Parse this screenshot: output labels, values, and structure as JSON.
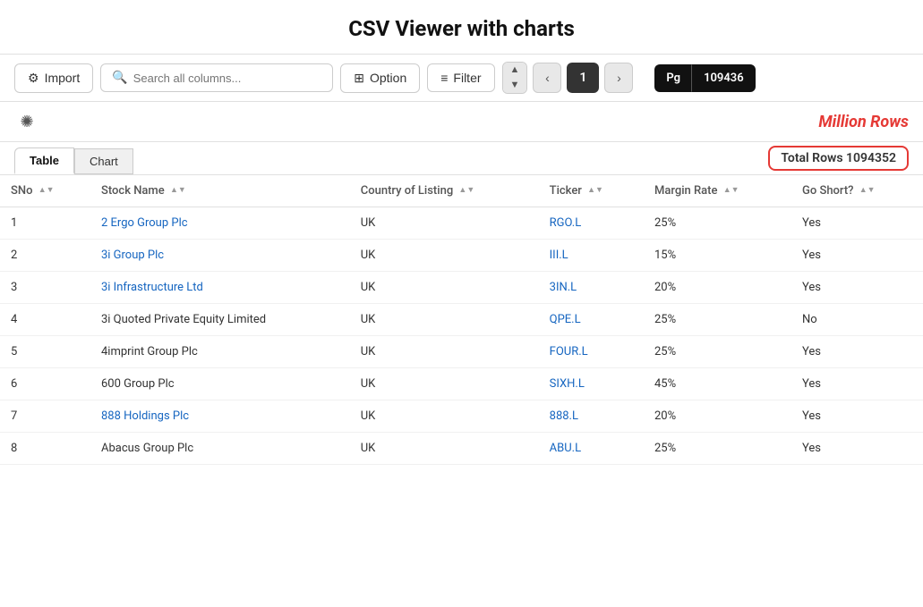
{
  "page": {
    "title": "CSV Viewer with charts"
  },
  "toolbar": {
    "import_label": "Import",
    "search_placeholder": "Search all columns...",
    "option_label": "Option",
    "filter_label": "Filter",
    "page_current": "1",
    "page_total": "109436",
    "pg_label": "Pg"
  },
  "million_rows": {
    "label": "Million Rows"
  },
  "tabs": [
    {
      "id": "table",
      "label": "Table",
      "active": true
    },
    {
      "id": "chart",
      "label": "Chart",
      "active": false
    }
  ],
  "total_rows": {
    "label": "Total Rows 1094352"
  },
  "table": {
    "columns": [
      {
        "id": "sno",
        "label": "SNo"
      },
      {
        "id": "stock_name",
        "label": "Stock Name"
      },
      {
        "id": "country",
        "label": "Country of Listing"
      },
      {
        "id": "ticker",
        "label": "Ticker"
      },
      {
        "id": "margin_rate",
        "label": "Margin Rate"
      },
      {
        "id": "go_short",
        "label": "Go Short?"
      }
    ],
    "rows": [
      {
        "sno": "1",
        "stock_name": "2 Ergo Group Plc",
        "country": "UK",
        "ticker": "RGO.L",
        "margin_rate": "25%",
        "go_short": "Yes",
        "stock_link": true,
        "ticker_link": false
      },
      {
        "sno": "2",
        "stock_name": "3i Group Plc",
        "country": "UK",
        "ticker": "III.L",
        "margin_rate": "15%",
        "go_short": "Yes",
        "stock_link": true,
        "ticker_link": false
      },
      {
        "sno": "3",
        "stock_name": "3i Infrastructure Ltd",
        "country": "UK",
        "ticker": "3IN.L",
        "margin_rate": "20%",
        "go_short": "Yes",
        "stock_link": true,
        "ticker_link": false
      },
      {
        "sno": "4",
        "stock_name": "3i Quoted Private Equity Limited",
        "country": "UK",
        "ticker": "QPE.L",
        "margin_rate": "25%",
        "go_short": "No",
        "stock_link": false,
        "ticker_link": false
      },
      {
        "sno": "5",
        "stock_name": "4imprint Group Plc",
        "country": "UK",
        "ticker": "FOUR.L",
        "margin_rate": "25%",
        "go_short": "Yes",
        "stock_link": false,
        "ticker_link": false
      },
      {
        "sno": "6",
        "stock_name": "600 Group Plc",
        "country": "UK",
        "ticker": "SIXH.L",
        "margin_rate": "45%",
        "go_short": "Yes",
        "stock_link": false,
        "ticker_link": false
      },
      {
        "sno": "7",
        "stock_name": "888 Holdings Plc",
        "country": "UK",
        "ticker": "888.L",
        "margin_rate": "20%",
        "go_short": "Yes",
        "stock_link": true,
        "ticker_link": false
      },
      {
        "sno": "8",
        "stock_name": "Abacus Group Plc",
        "country": "UK",
        "ticker": "ABU.L",
        "margin_rate": "25%",
        "go_short": "Yes",
        "stock_link": false,
        "ticker_link": false
      }
    ]
  }
}
